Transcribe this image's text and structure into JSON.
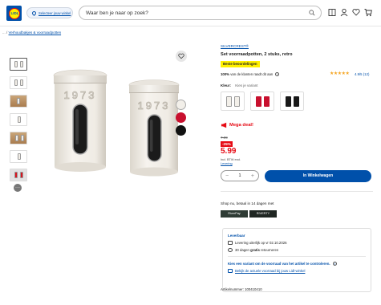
{
  "header": {
    "logo_text": "LIDL",
    "store_label": "Selecteer jouw winkel",
    "search_placeholder": "Waar ben je naar op zoek?"
  },
  "breadcrumb": {
    "prefix": "... /",
    "current": "Verhoudbakjes & voorraadpotten"
  },
  "gallery": {
    "more_label": "···",
    "image_text": "1973"
  },
  "product": {
    "brand": "SILVERCREST®",
    "title": "Set voorraadpotten, 2 stuks, retro",
    "badge": "Beste beoordelingen",
    "recommend_pct": "100%",
    "recommend_text": "van de klanten raadt dit aan",
    "stars": "★★★★★",
    "rating": "4.9/5 (12)",
    "colour_label": "Kleur:",
    "colour_hint": "Kies je variant",
    "deal_label": "Mega deal!",
    "old_price": "7.99",
    "discount": "-25%",
    "price": "5.99",
    "vat_note": "Incl. BTW excl.",
    "shipping_link": "Levering",
    "quantity": "1",
    "add_to_cart": "In Winkelwagen",
    "shop_now": "Shop nu, betaal in 14 dagen met",
    "pay1": "RiverPay",
    "pay2": "RIVERTY",
    "article_number": "Artikelnummer: 100410410"
  },
  "delivery": {
    "title": "Leverbaar",
    "line1": "Levering uiterlijk op vr 02.10.2026",
    "line2_pre": "30 dagen",
    "line2_bold": "gratis",
    "line2_post": "retourneren",
    "choose_text": "Kies een variant om de voorraad van het artikel te controleren.",
    "stock_link": "Bekijk de actuele voorraad bij jouw Lidl-winkel"
  },
  "colors": {
    "brand_blue": "#0050aa",
    "deal_red": "#e60a14",
    "badge_yellow": "#fff000"
  }
}
